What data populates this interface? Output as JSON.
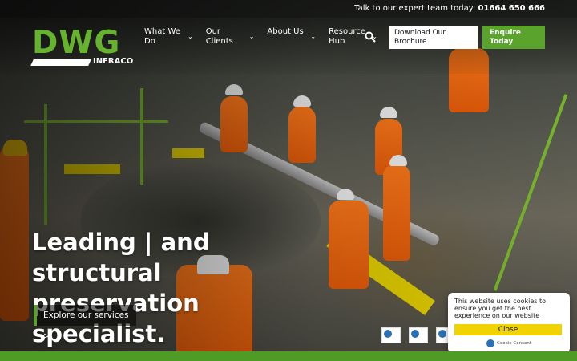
{
  "topbar": {
    "prefix": "Talk to our expert team today:",
    "phone": "01664 650 666"
  },
  "logo": {
    "main": "DWG",
    "sub": "INFRACO"
  },
  "nav": {
    "items": [
      {
        "label": "What We Do",
        "has_dropdown": true
      },
      {
        "label": "Our Clients",
        "has_dropdown": true
      },
      {
        "label": "About Us",
        "has_dropdown": true
      },
      {
        "label": "Resource Hub",
        "has_dropdown": true
      }
    ],
    "search_icon": "search-icon"
  },
  "cta": {
    "brochure": "Download Our Brochure",
    "enquire": "Enquire Today"
  },
  "hero": {
    "headline_line1": "Leading | and structural",
    "headline_line2": "preservation specialist.",
    "explore_label": "Explore our services >"
  },
  "cookie": {
    "message": "This website uses cookies to ensure you get the best experience on our website",
    "close_label": "Close",
    "provider": "Cookie Consent"
  },
  "colors": {
    "brand_green": "#5aa32c",
    "accent_yellow": "#f1d302",
    "white": "#ffffff"
  }
}
